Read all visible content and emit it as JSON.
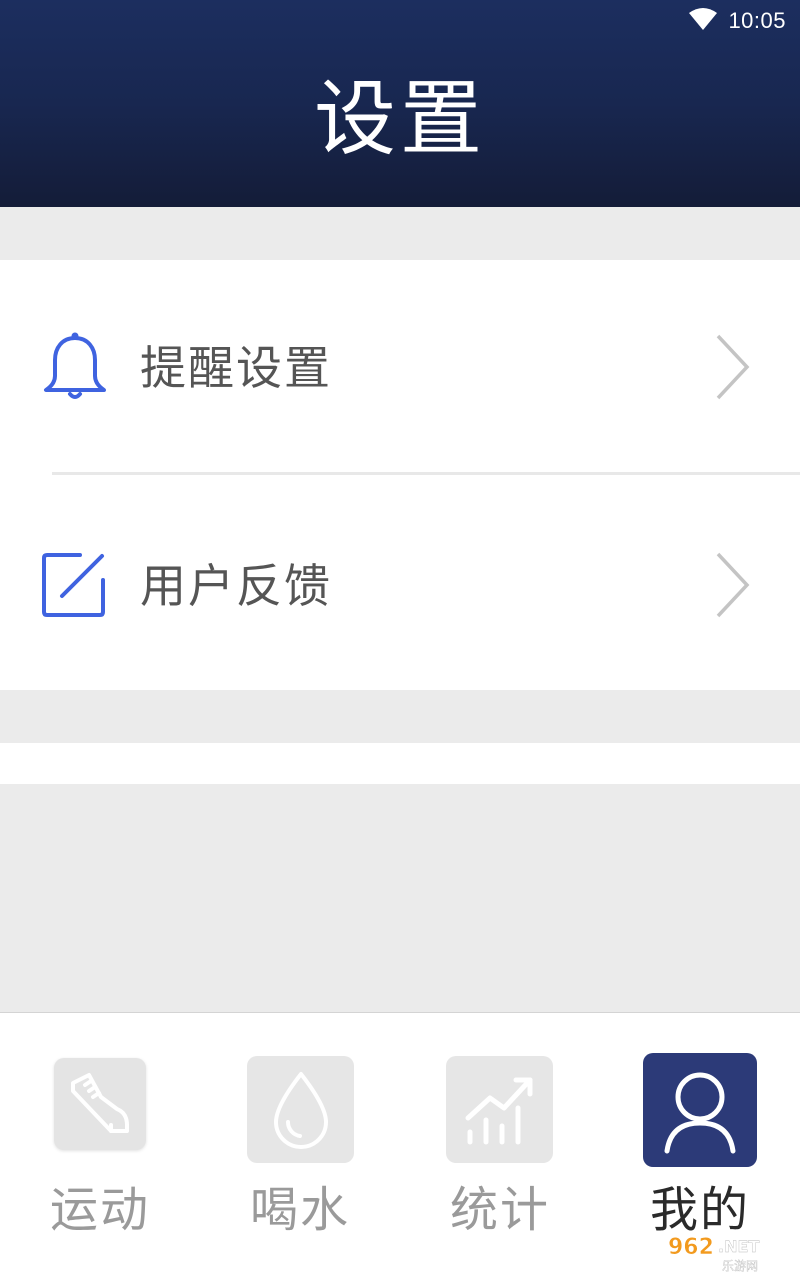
{
  "status_bar": {
    "time": "10:05",
    "wifi_icon": "wifi-icon"
  },
  "header": {
    "title": "设置"
  },
  "settings": {
    "items": [
      {
        "label": "提醒设置",
        "icon": "bell-icon"
      },
      {
        "label": "用户反馈",
        "icon": "edit-icon"
      }
    ]
  },
  "tabbar": {
    "tabs": [
      {
        "label": "运动",
        "icon": "shoe-icon",
        "active": false
      },
      {
        "label": "喝水",
        "icon": "water-drop-icon",
        "active": false
      },
      {
        "label": "统计",
        "icon": "stats-chart-icon",
        "active": false
      },
      {
        "label": "我的",
        "icon": "user-icon",
        "active": true
      }
    ]
  },
  "watermark": {
    "text_main": "962.NET",
    "text_sub": "乐游网"
  },
  "colors": {
    "header_top": "#1c2e5f",
    "header_bottom": "#141c38",
    "icon_blue": "#3f63e0",
    "active_tab_bg": "#2c3a78",
    "inactive_tab_bg": "#e6e6e6",
    "background": "#ebebeb"
  }
}
